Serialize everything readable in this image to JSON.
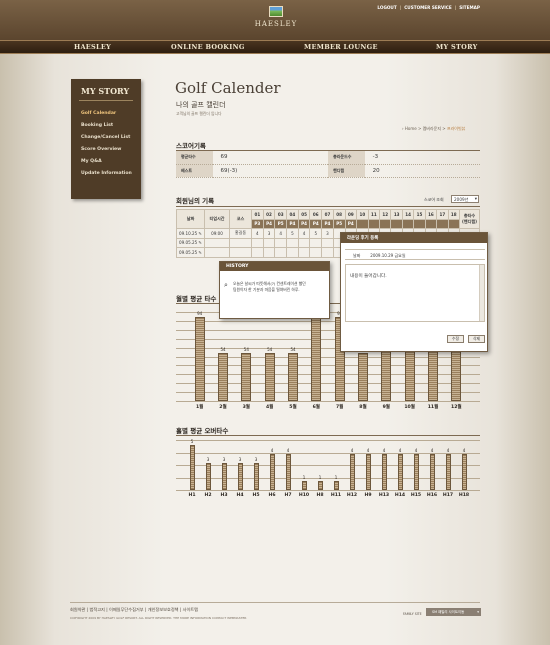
{
  "header": {
    "brand": "HAESLEY",
    "utility": [
      "LOGOUT",
      "CUSTOMER SERVICE",
      "SITEMAP"
    ],
    "nav": [
      "HAESLEY",
      "ONLINE BOOKING",
      "MEMBER LOUNGE",
      "MY STORY"
    ]
  },
  "sidebar": {
    "title": "MY STORY",
    "items": [
      "Golf Calendar",
      "Booking List",
      "Change/Cancel List",
      "Score Overview",
      "My Q&A",
      "Update Information"
    ]
  },
  "page": {
    "title": "Golf Calender",
    "subtitle": "나의 골프 캘린더",
    "desc": "고객님의 골프 캘린더 입니다",
    "breadcrumb": [
      "Home",
      "멤버라운지",
      "프라이빗뷰"
    ]
  },
  "score": {
    "title": "스코어기록",
    "rows": [
      [
        {
          "label": "평균타수",
          "value": "69"
        },
        {
          "label": "총라운드수",
          "value": "-3"
        }
      ],
      [
        {
          "label": "베스트",
          "value": "69(-3)"
        },
        {
          "label": "핸디캡",
          "value": "20"
        }
      ]
    ]
  },
  "members": {
    "title": "회원님의 기록",
    "year_label": "스코어 조회",
    "year_value": "2009년",
    "headers": {
      "date": "날짜",
      "tee_time": "티업시간",
      "course": "코스",
      "holes": [
        "01",
        "02",
        "03",
        "04",
        "05",
        "06",
        "07",
        "08",
        "09",
        "10",
        "11",
        "12",
        "13",
        "14",
        "15",
        "16",
        "17",
        "18"
      ],
      "total": "총타수",
      "total_sub": "(핸디캡)"
    },
    "par": [
      "P3",
      "P4",
      "P5",
      "P4",
      "P4",
      "P4",
      "P4",
      "P5",
      "P4"
    ],
    "rows": [
      {
        "date": "09.10.25",
        "time": "09:00",
        "course": "홍길동",
        "scores": [
          "4",
          "3",
          "4",
          "5",
          "4",
          "5",
          "3"
        ]
      },
      {
        "date": "09.05.25",
        "time": "",
        "course": "",
        "scores": []
      },
      {
        "date": "09.05.25",
        "time": "",
        "course": "",
        "scores": []
      }
    ]
  },
  "monthly_chart": {
    "title": "월별 평균 타수"
  },
  "hole_chart": {
    "title": "홀별 평균 오버타수"
  },
  "chart_data": [
    {
      "type": "bar",
      "title": "월별 평균 타수",
      "categories": [
        "1월",
        "2월",
        "3월",
        "4월",
        "5월",
        "6월",
        "7월",
        "8월",
        "9월",
        "10월",
        "11월",
        "12월"
      ],
      "values": [
        94,
        54,
        54,
        54,
        54,
        94,
        94,
        54,
        94,
        94,
        94,
        94
      ]
    },
    {
      "type": "bar",
      "title": "홀별 평균 오버타수",
      "categories": [
        "H1",
        "H2",
        "H3",
        "H4",
        "H5",
        "H6",
        "H7",
        "H10",
        "H8",
        "H11",
        "H12",
        "H9",
        "H13",
        "H14",
        "H15",
        "H16",
        "H17",
        "H18"
      ],
      "values": [
        5,
        3,
        3,
        3,
        3,
        4,
        4,
        1,
        1,
        1,
        4,
        4,
        4,
        4,
        4,
        4,
        4,
        4
      ]
    }
  ],
  "popups": {
    "history": {
      "title": "HISTORY",
      "text1": "오늘은 날씨가 따뜻해서(?) 컨센트레이션 했던",
      "text2": "팀원이자 한 기분과 마음을 떨쳐버린 하루."
    },
    "review": {
      "title": "라운딩 후기 등록",
      "date_label": "날짜",
      "date_value": "2009.10.29 금요일",
      "body": "내용이 들어갑니다.",
      "buttons": [
        "수정",
        "삭제"
      ]
    }
  },
  "footer": {
    "links": "회원약관  |  법적고지  |  이메일무단수집거부  |  개인정보보호정책  |  사이트맵",
    "copyright": "COPYRIGHT 2009 BY HAESLEY GOLF RESORT. ALL RIGHT RESERVED.   THE MORE INFORMATION CONTACT WEBMASTER",
    "family_label": "FAMILY SITE",
    "family_value": "SM 패밀리 사이트이동"
  },
  "colors": {
    "brand_brown": "#5b452e",
    "accent": "#b67a3a"
  }
}
